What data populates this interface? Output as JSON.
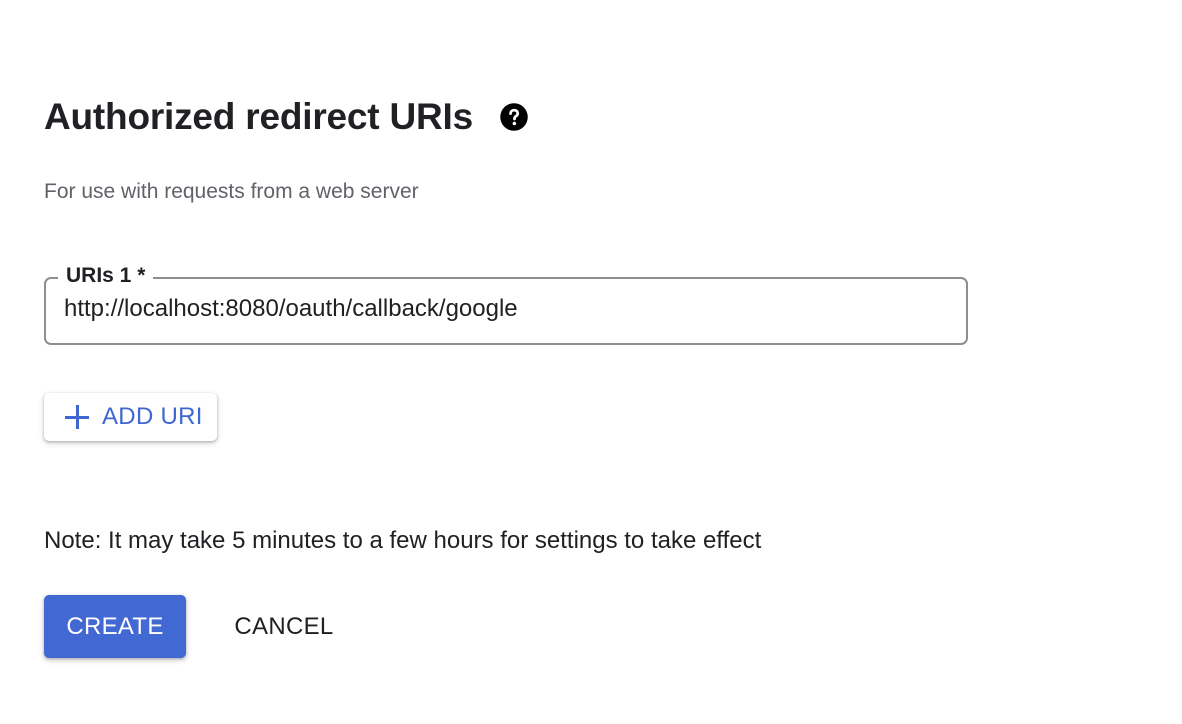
{
  "section": {
    "title": "Authorized redirect URIs",
    "help_icon": "help-circle-icon",
    "subtitle": "For use with requests from a web server"
  },
  "uri_field": {
    "label": "URIs 1 *",
    "value": "http://localhost:8080/oauth/callback/google"
  },
  "add_uri_button": {
    "icon": "plus-icon",
    "label": "ADD URI"
  },
  "note": "Note: It may take 5 minutes to a few hours for settings to take effect",
  "actions": {
    "create_label": "CREATE",
    "cancel_label": "CANCEL"
  },
  "colors": {
    "accent": "#4168d3",
    "link_blue": "#3f67d1",
    "text": "#202124",
    "secondary_text": "#5f6368",
    "field_border": "#8e8e8e"
  }
}
